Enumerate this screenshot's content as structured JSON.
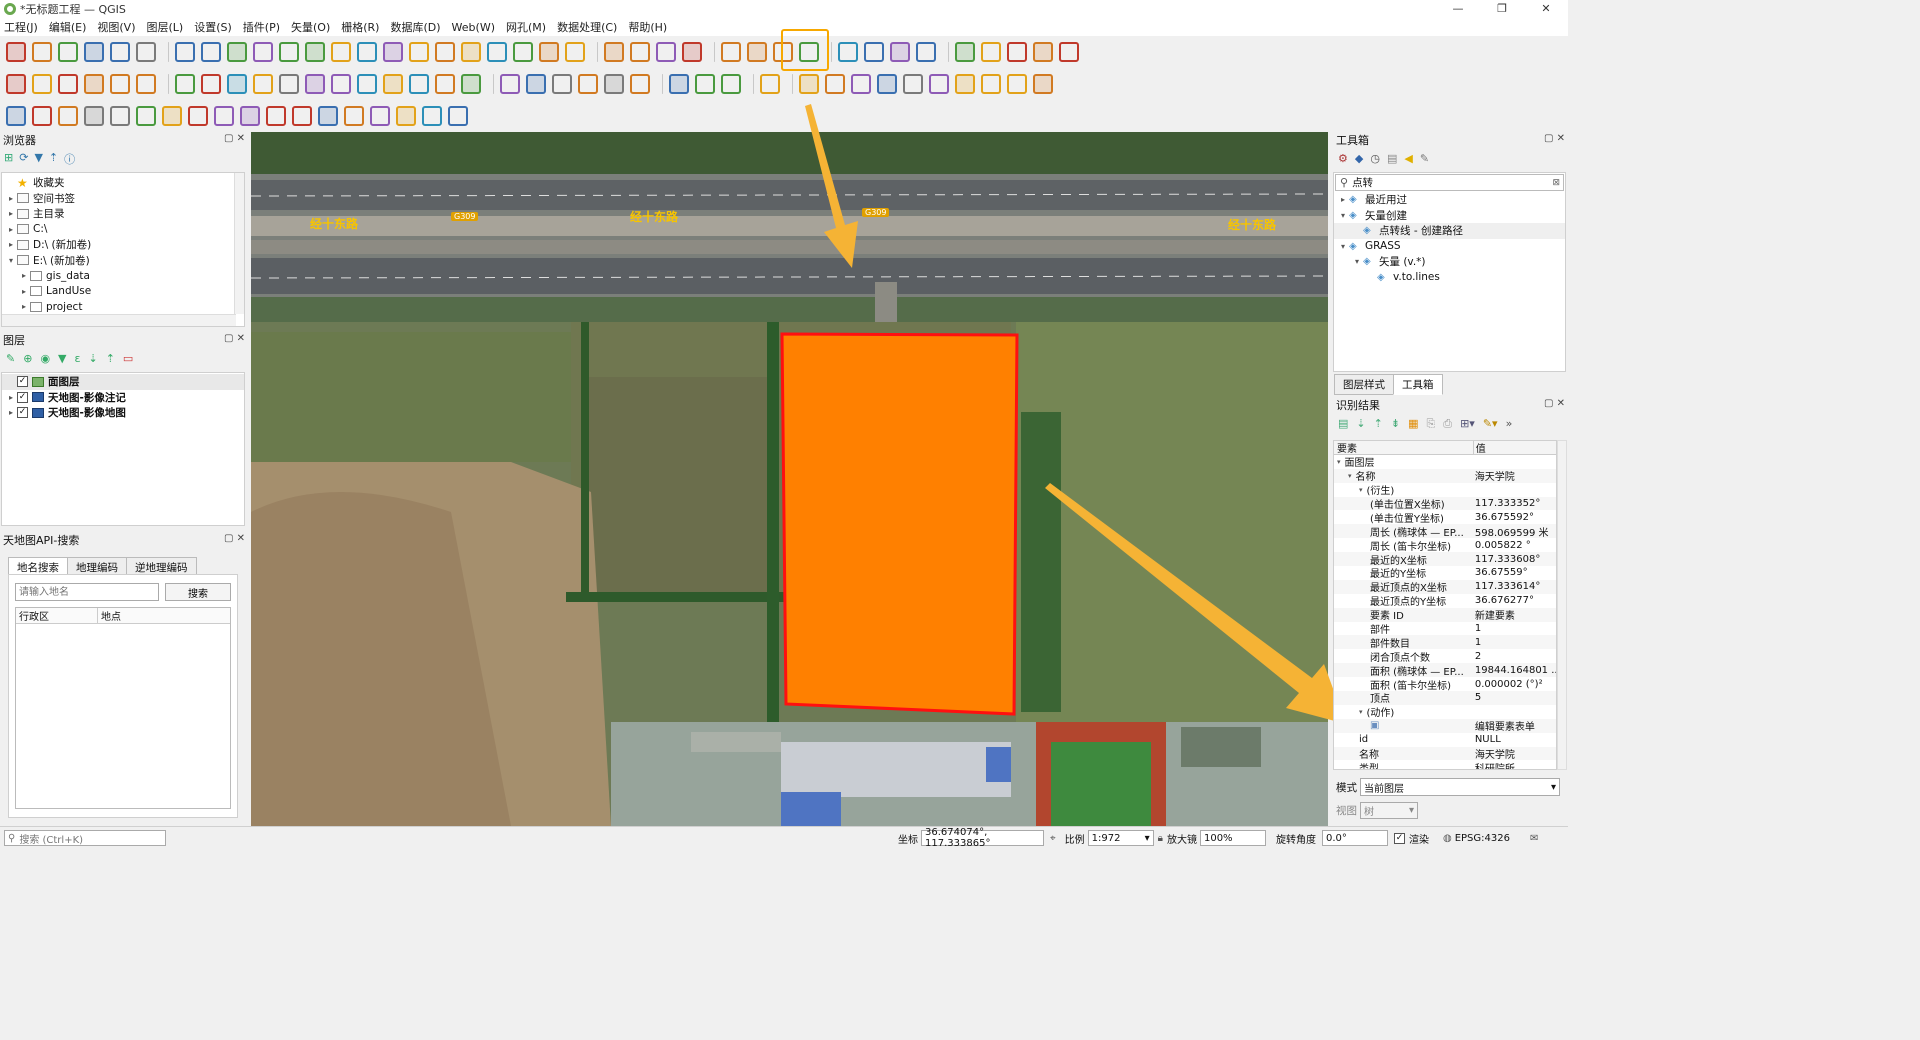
{
  "window": {
    "title": "*无标题工程 — QGIS",
    "min": "—",
    "max": "❐",
    "close": "✕"
  },
  "menu": [
    "工程(J)",
    "编辑(E)",
    "视图(V)",
    "图层(L)",
    "设置(S)",
    "插件(P)",
    "矢量(O)",
    "栅格(R)",
    "数据库(D)",
    "Web(W)",
    "网孔(M)",
    "数据处理(C)",
    "帮助(H)"
  ],
  "colors": {
    "accent_highlight": "#f7a800",
    "polygon_fill": "#ff8000",
    "polygon_stroke": "#ff1010",
    "arrow": "#f5b335"
  },
  "browser": {
    "title": "浏览器",
    "items": [
      {
        "label": "收藏夹",
        "icon": "star-icon",
        "level": 0,
        "expand": ""
      },
      {
        "label": "空间书签",
        "icon": "bookmark-icon",
        "level": 0,
        "expand": "▸"
      },
      {
        "label": "主目录",
        "icon": "home-folder-icon",
        "level": 0,
        "expand": "▸"
      },
      {
        "label": "C:\\",
        "icon": "drive-icon",
        "level": 0,
        "expand": "▸"
      },
      {
        "label": "D:\\ (新加卷)",
        "icon": "drive-icon",
        "level": 0,
        "expand": "▸"
      },
      {
        "label": "E:\\ (新加卷)",
        "icon": "drive-icon",
        "level": 0,
        "expand": "▾"
      },
      {
        "label": "gis_data",
        "icon": "folder-icon",
        "level": 1,
        "expand": "▸"
      },
      {
        "label": "LandUse",
        "icon": "folder-icon",
        "level": 1,
        "expand": "▸"
      },
      {
        "label": "project",
        "icon": "folder-icon",
        "level": 1,
        "expand": "▸"
      }
    ]
  },
  "layers": {
    "title": "图层",
    "items": [
      {
        "label": "面图层",
        "checked": "✓",
        "icon": "polygon-layer-icon"
      },
      {
        "label": "天地图-影像注记",
        "checked": "✓",
        "icon": "raster-layer-icon"
      },
      {
        "label": "天地图-影像地图",
        "checked": "✓",
        "icon": "raster-layer-icon"
      }
    ]
  },
  "tianditu": {
    "title": "天地图API-搜索",
    "tabs": [
      "地名搜索",
      "地理编码",
      "逆地理编码"
    ],
    "placeholder": "请输入地名",
    "search_button": "搜索",
    "columns": [
      "行政区",
      "地点"
    ]
  },
  "toolbox": {
    "title": "工具箱",
    "search_value": "点转",
    "tree": [
      {
        "label": "最近用过",
        "level": 0,
        "expand": "▸"
      },
      {
        "label": "矢量创建",
        "level": 0,
        "expand": "▾"
      },
      {
        "label": "点转线 - 创建路径",
        "level": 1,
        "expand": ""
      },
      {
        "label": "GRASS",
        "level": 0,
        "expand": "▾"
      },
      {
        "label": "矢量 (v.*)",
        "level": 1,
        "expand": "▾"
      },
      {
        "label": "v.to.lines",
        "level": 2,
        "expand": ""
      }
    ],
    "tabs": [
      "图层样式",
      "工具箱"
    ]
  },
  "identify": {
    "title": "识别结果",
    "col_feature": "要素",
    "col_value": "值",
    "rows": [
      {
        "k": "面图层",
        "v": "",
        "level": 0
      },
      {
        "k": "名称",
        "v": "海天学院",
        "level": 1
      },
      {
        "k": "(衍生)",
        "v": "",
        "level": 2
      },
      {
        "k": "(单击位置X坐标)",
        "v": "117.333352°",
        "level": 3
      },
      {
        "k": "(单击位置Y坐标)",
        "v": "36.675592°",
        "level": 3
      },
      {
        "k": "周长 (椭球体 — EP...",
        "v": "598.069599 米",
        "level": 3
      },
      {
        "k": "周长 (笛卡尔坐标)",
        "v": "0.005822 °",
        "level": 3
      },
      {
        "k": "最近的X坐标",
        "v": "117.333608°",
        "level": 3
      },
      {
        "k": "最近的Y坐标",
        "v": "36.67559°",
        "level": 3
      },
      {
        "k": "最近顶点的X坐标",
        "v": "117.333614°",
        "level": 3
      },
      {
        "k": "最近顶点的Y坐标",
        "v": "36.676277°",
        "level": 3
      },
      {
        "k": "要素 ID",
        "v": "新建要素",
        "level": 3
      },
      {
        "k": "部件",
        "v": "1",
        "level": 3
      },
      {
        "k": "部件数目",
        "v": "1",
        "level": 3
      },
      {
        "k": "闭合顶点个数",
        "v": "2",
        "level": 3
      },
      {
        "k": "面积 (椭球体 — EP...",
        "v": "19844.164801 ...",
        "level": 3
      },
      {
        "k": "面积 (笛卡尔坐标)",
        "v": "0.000002 (°)²",
        "level": 3
      },
      {
        "k": "顶点",
        "v": "5",
        "level": 3
      },
      {
        "k": "(动作)",
        "v": "",
        "level": 2
      },
      {
        "k": "",
        "v": "编辑要素表单",
        "level": 3
      },
      {
        "k": "id",
        "v": "NULL",
        "level": 2
      },
      {
        "k": "名称",
        "v": "海天学院",
        "level": 2
      },
      {
        "k": "类型",
        "v": "科研院所",
        "level": 2
      }
    ],
    "mode_label": "模式",
    "mode_value": "当前图层",
    "view_label": "视图",
    "view_value": "树"
  },
  "map": {
    "road_labels": [
      "经十东路",
      "经十东路",
      "经十东路"
    ],
    "shields": [
      "G309",
      "G309"
    ]
  },
  "status": {
    "search_placeholder": "搜索 (Ctrl+K)",
    "coord_label": "坐标",
    "coord_value": "36.674074°, 117.333865°",
    "scale_label": "比例",
    "scale_value": "1:972",
    "mag_label": "放大镜",
    "mag_value": "100%",
    "rot_label": "旋转角度",
    "rot_value": "0.0°",
    "render_label": "渲染",
    "crs": "EPSG:4326"
  }
}
